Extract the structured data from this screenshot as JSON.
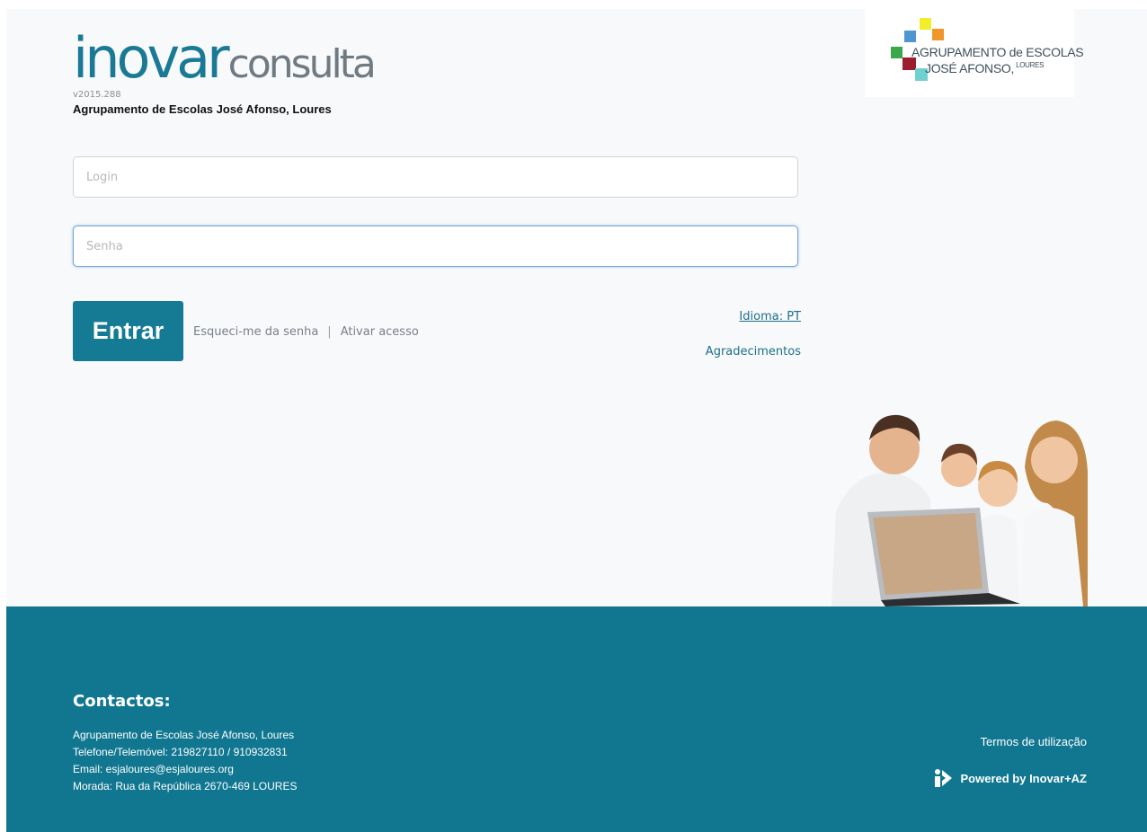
{
  "brand": {
    "logo_part1": "inovar",
    "logo_part2": "consulta",
    "version": "v2015.288",
    "school_name": "Agrupamento de Escolas José Afonso, Loures"
  },
  "school_logo": {
    "line1": "AGRUPAMENTO de ESCOLAS",
    "line2": "JOSÉ AFONSO,",
    "line2_small": "LOURES"
  },
  "form": {
    "login_placeholder": "Login",
    "password_placeholder": "Senha",
    "submit_label": "Entrar",
    "forgot_label": "Esqueci-me da senha",
    "separator": "|",
    "activate_label": "Ativar acesso",
    "language_label": "Idioma: PT",
    "thanks_label": "Agradecimentos"
  },
  "footer": {
    "title": "Contactos:",
    "lines": [
      "Agrupamento de Escolas José Afonso, Loures",
      "Telefone/Telemóvel: 219827110 / 910932831",
      "Email: esjaloures@esjaloures.org",
      "Morada: Rua da República 2670-469 LOURES"
    ],
    "terms_label": "Termos de utilização",
    "powered_label": "Powered by Inovar+AZ"
  },
  "colors": {
    "brand_teal": "#157b94",
    "footer_bg": "#117791",
    "link_blue": "#1b6f8a"
  },
  "icons": [
    "inovar-logo-icon",
    "school-logo-squares",
    "family-photo",
    "powered-logo-icon"
  ]
}
